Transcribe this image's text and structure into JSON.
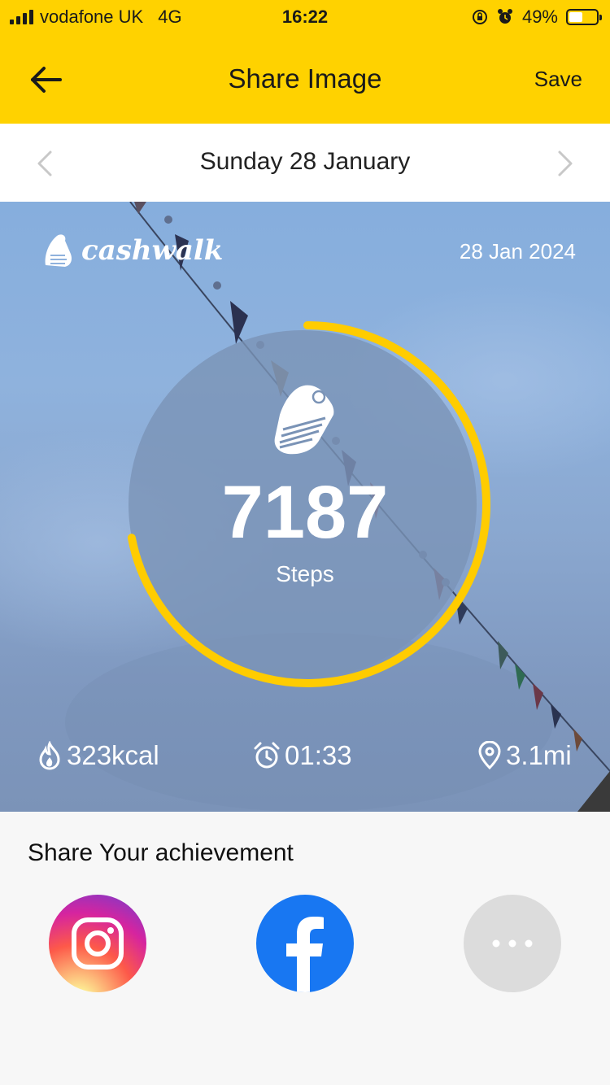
{
  "status_bar": {
    "carrier": "vodafone UK",
    "network": "4G",
    "time": "16:22",
    "battery": "49%",
    "battery_level": 0.49
  },
  "nav": {
    "title": "Share Image",
    "save_label": "Save"
  },
  "date_nav": {
    "label": "Sunday 28 January"
  },
  "card": {
    "brand": "cashwalk",
    "date": "28 Jan 2024",
    "steps": "7187",
    "steps_label": "Steps",
    "goal_progress": 0.72,
    "calories": "323kcal",
    "duration": "01:33",
    "distance": "3.1mi"
  },
  "share": {
    "title": "Share Your achievement",
    "targets": [
      "instagram",
      "facebook",
      "more"
    ]
  },
  "colors": {
    "header": "#ffd200",
    "ring": "#ffcc00",
    "facebook": "#1877f2"
  }
}
